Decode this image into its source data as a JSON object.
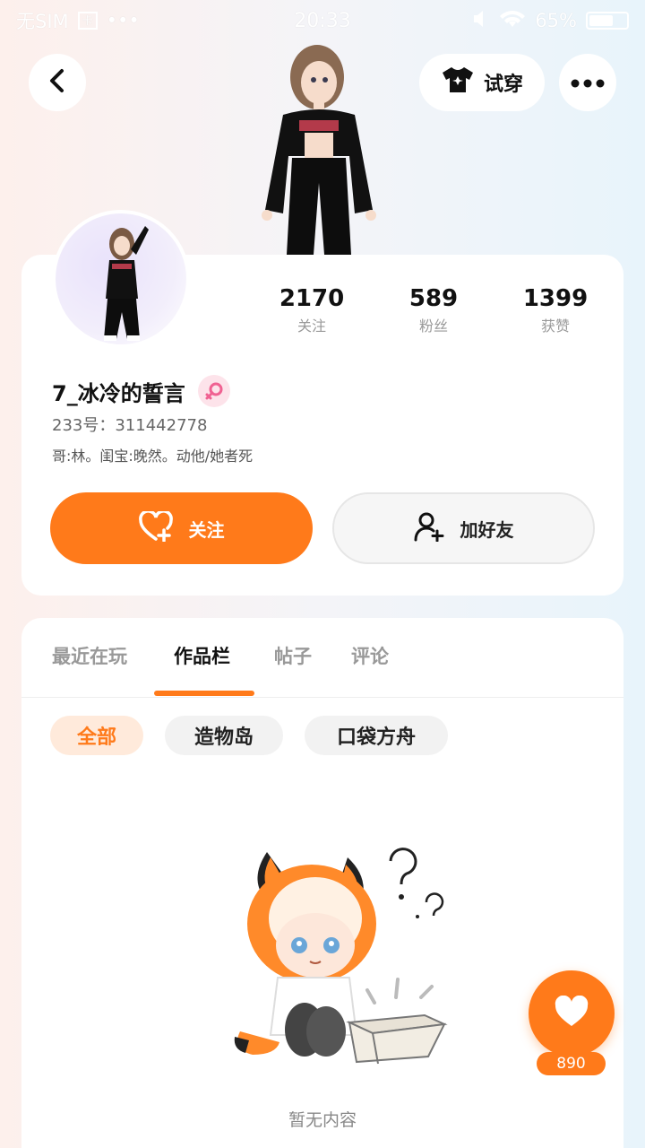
{
  "status_bar": {
    "carrier": "无SIM",
    "sim_label": "卡",
    "dots": "•••",
    "time": "20:33",
    "battery": "65%"
  },
  "header": {
    "tryon_label": "试穿",
    "back_icon": "chevron-left-icon",
    "more_icon": "more-dots-icon"
  },
  "profile": {
    "stats": [
      {
        "value": "2170",
        "label": "关注"
      },
      {
        "value": "589",
        "label": "粉丝"
      },
      {
        "value": "1399",
        "label": "获赞"
      }
    ],
    "username": "7_冰冷的誓言",
    "id_line": "233号：311442778",
    "bio": "哥:林。闺宝:晚然。动他/她者死",
    "follow_label": "关注",
    "add_friend_label": "加好友"
  },
  "tabs": [
    {
      "label": "最近在玩",
      "active": false
    },
    {
      "label": "作品栏",
      "active": true
    },
    {
      "label": "帖子",
      "active": false
    },
    {
      "label": "评论",
      "active": false
    }
  ],
  "chips": [
    {
      "label": "全部",
      "active": true
    },
    {
      "label": "造物岛",
      "active": false
    },
    {
      "label": "口袋方舟",
      "active": false
    }
  ],
  "empty_text": "暂无内容",
  "like_fab": {
    "count": "890"
  },
  "colors": {
    "accent": "#ff7a1a",
    "accent_light": "#ffeadb",
    "gender_pink": "#f06292"
  }
}
